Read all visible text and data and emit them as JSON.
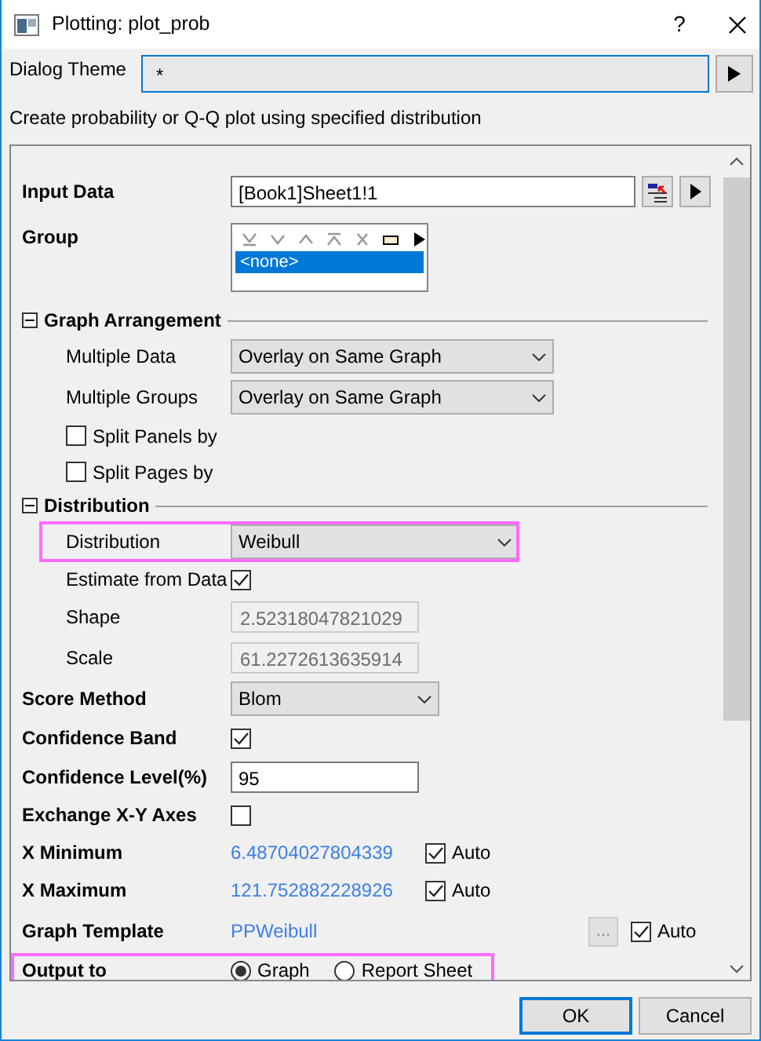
{
  "window": {
    "title": "Plotting: plot_prob",
    "help": "?"
  },
  "dialog_theme": {
    "label": "Dialog Theme",
    "value": "*"
  },
  "description": "Create probability or Q-Q plot using specified distribution",
  "rows": [
    {
      "kind": "input",
      "label": "Input Data",
      "value": "[Book1]Sheet1!1"
    },
    {
      "kind": "grouplist",
      "label": "Group",
      "items": [
        {
          "text": "<none>",
          "selected": true
        }
      ]
    },
    {
      "kind": "section",
      "label": "Graph Arrangement",
      "expanded": true,
      "children": [
        {
          "kind": "combo",
          "label": "Multiple Data",
          "value": "Overlay on Same Graph"
        },
        {
          "kind": "combo",
          "label": "Multiple Groups",
          "value": "Overlay on Same Graph"
        },
        {
          "kind": "checkbox",
          "label": "Split Panels by",
          "checked": false
        },
        {
          "kind": "checkbox",
          "label": "Split Pages by",
          "checked": false
        }
      ]
    },
    {
      "kind": "section",
      "label": "Distribution",
      "expanded": true,
      "children": [
        {
          "kind": "combo",
          "label": "Distribution",
          "value": "Weibull",
          "highlighted": true
        },
        {
          "kind": "check",
          "label": "Estimate from Data",
          "checked": true
        },
        {
          "kind": "readonly",
          "label": "Shape",
          "value": "2.52318047821029",
          "disabled": true
        },
        {
          "kind": "readonly",
          "label": "Scale",
          "value": "61.2272613635914",
          "disabled": true
        }
      ]
    },
    {
      "kind": "combo",
      "label": "Score Method",
      "value": "Blom"
    },
    {
      "kind": "check",
      "label": "Confidence Band",
      "checked": true
    },
    {
      "kind": "input",
      "label": "Confidence Level(%)",
      "value": "95",
      "short": true
    },
    {
      "kind": "check",
      "label": "Exchange X-Y Axes",
      "checked": false
    },
    {
      "kind": "auto",
      "label": "X Minimum",
      "value": "6.48704027804339",
      "auto_label": "Auto",
      "auto": true
    },
    {
      "kind": "auto",
      "label": "X Maximum",
      "value": "121.752882228926",
      "auto_label": "Auto",
      "auto": true
    },
    {
      "kind": "template",
      "label": "Graph Template",
      "value": "PPWeibull",
      "button": "...",
      "auto_label": "Auto",
      "auto": true
    },
    {
      "kind": "radios",
      "label": "Output to",
      "highlighted": true,
      "options": [
        {
          "label": "Graph",
          "selected": true
        },
        {
          "label": "Report Sheet",
          "selected": false
        }
      ]
    }
  ],
  "buttons": [
    {
      "label": "OK",
      "default": true
    },
    {
      "label": "Cancel",
      "default": false
    }
  ]
}
